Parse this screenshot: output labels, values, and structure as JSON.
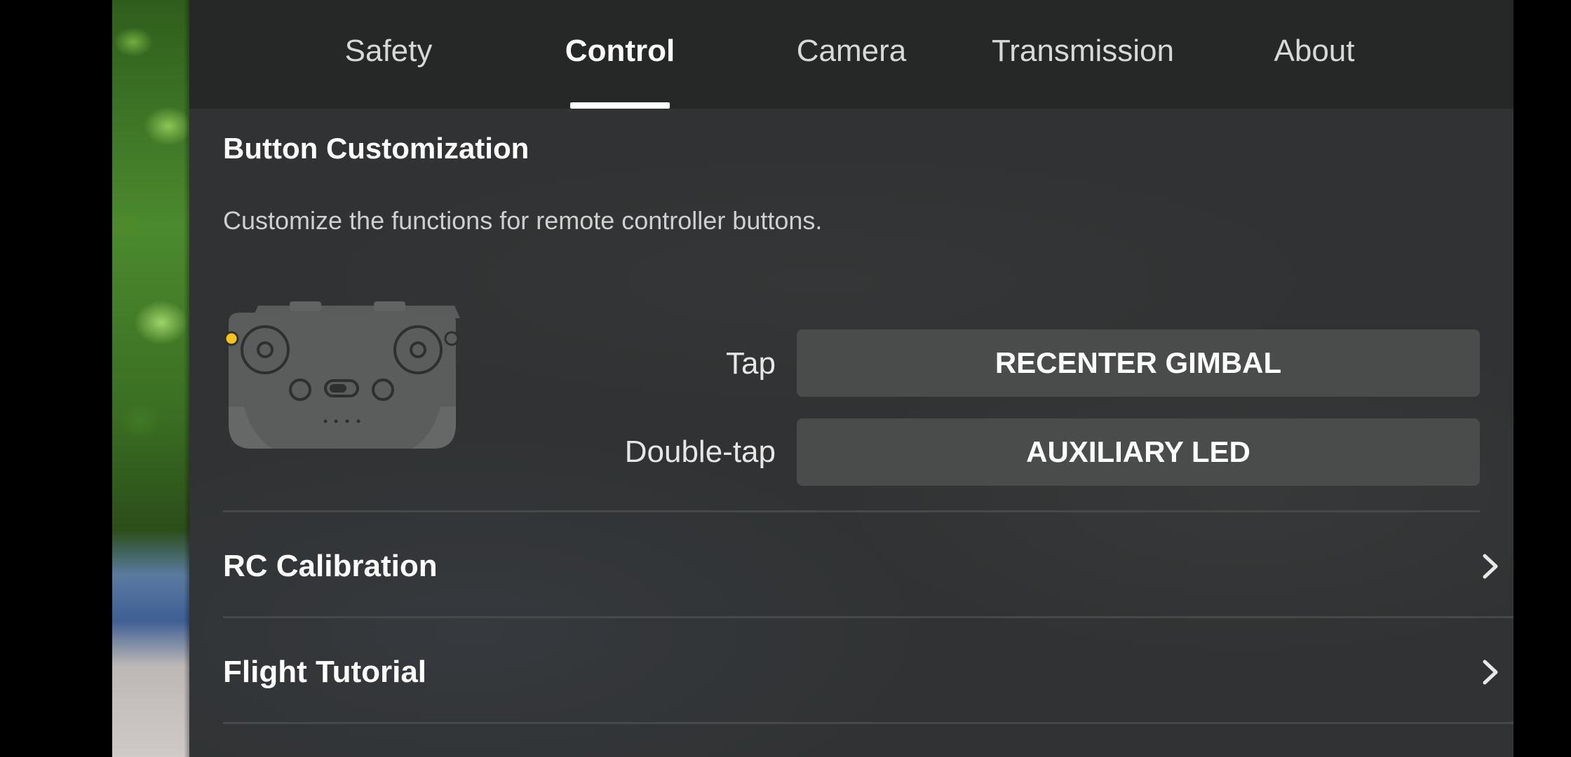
{
  "tabs": [
    {
      "label": "Safety",
      "active": false
    },
    {
      "label": "Control",
      "active": true
    },
    {
      "label": "Camera",
      "active": false
    },
    {
      "label": "Transmission",
      "active": false
    },
    {
      "label": "About",
      "active": false
    }
  ],
  "button_customization": {
    "title": "Button Customization",
    "description": "Customize the functions for remote controller buttons.",
    "highlight_color": "#f5c518",
    "tap": {
      "label": "Tap",
      "value": "RECENTER GIMBAL"
    },
    "double_tap": {
      "label": "Double-tap",
      "value": "AUXILIARY LED"
    }
  },
  "rows": [
    {
      "label": "RC Calibration",
      "icon": "chevron-right-icon"
    },
    {
      "label": "Flight Tutorial",
      "icon": "chevron-right-icon"
    }
  ],
  "colors": {
    "panel_background": "#303233",
    "tab_bar_background": "#262828",
    "button_background": "#4a4b4b",
    "text_primary": "#ffffff"
  }
}
